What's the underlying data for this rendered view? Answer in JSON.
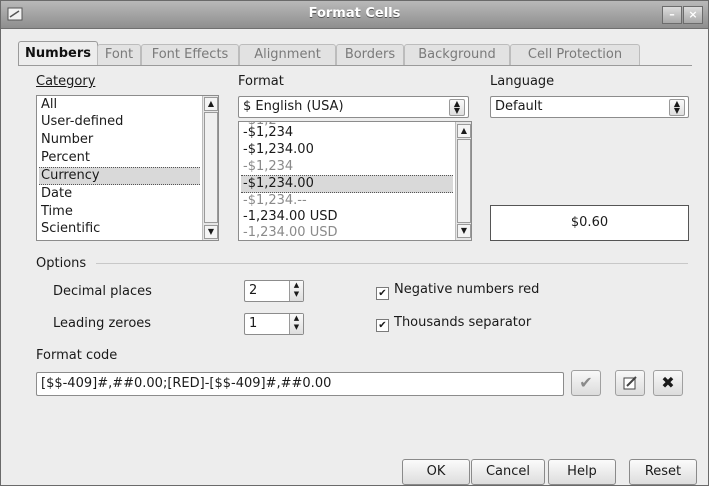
{
  "window": {
    "title": "Format Cells"
  },
  "tabs": [
    {
      "label": "Numbers"
    },
    {
      "label": "Font"
    },
    {
      "label": "Font Effects"
    },
    {
      "label": "Alignment"
    },
    {
      "label": "Borders"
    },
    {
      "label": "Background"
    },
    {
      "label": "Cell Protection"
    }
  ],
  "category": {
    "label": "Category",
    "items": [
      "All",
      "User-defined",
      "Number",
      "Percent",
      "Currency",
      "Date",
      "Time",
      "Scientific"
    ],
    "selected": "Currency"
  },
  "format": {
    "label": "Format",
    "currency_value": "$ English (USA)",
    "partial_item": "-$1,2",
    "items": [
      "-$1,234",
      "-$1,234.00",
      "-$1,234",
      "-$1,234.00",
      "-$1,234.--",
      "-1,234.00 USD",
      "-1,234.00 USD"
    ],
    "selected_index": 3
  },
  "language": {
    "label": "Language",
    "value": "Default"
  },
  "preview": {
    "value": "$0.60"
  },
  "options": {
    "label": "Options",
    "decimal_places_label": "Decimal places",
    "decimal_places_value": "2",
    "leading_zeroes_label": "Leading zeroes",
    "leading_zeroes_value": "1",
    "negative_red_label": "Negative numbers red",
    "negative_red_checked": true,
    "thousands_sep_label": "Thousands separator",
    "thousands_sep_checked": true
  },
  "format_code": {
    "label": "Format code",
    "value": "[$$-409]#,##0.00;[RED]-[$$-409]#,##0.00"
  },
  "buttons": {
    "ok": "OK",
    "cancel": "Cancel",
    "help": "Help",
    "reset": "Reset"
  }
}
